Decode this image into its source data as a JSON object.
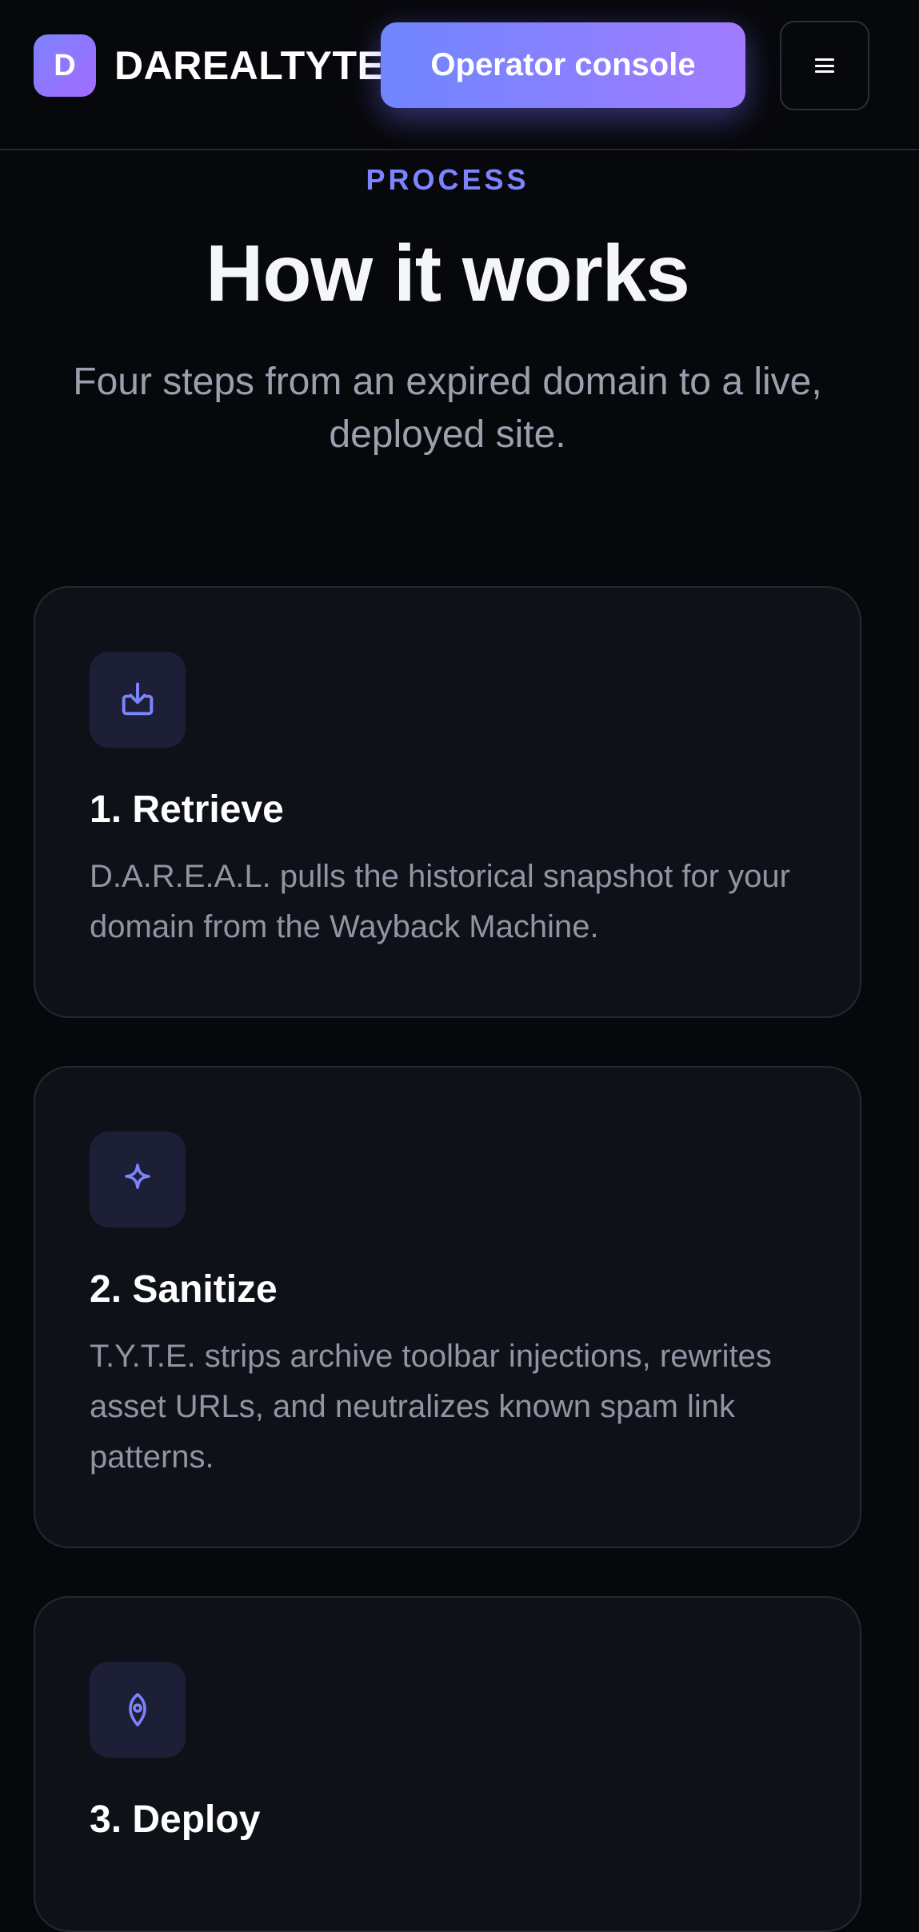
{
  "header": {
    "logo_letter": "D",
    "brand": "DAREALTYTE",
    "console_label": "Operator console",
    "menu_icon": "hamburger-menu-icon"
  },
  "section": {
    "eyebrow": "PROCESS",
    "title": "How it works",
    "subtitle": "Four steps from an expired domain to a live, deployed site."
  },
  "steps": [
    {
      "icon": "download-tray-icon",
      "title": "1. Retrieve",
      "body": "D.A.R.E.A.L. pulls the historical snapshot for your domain from the Wayback Machine."
    },
    {
      "icon": "sparkle-icon",
      "title": "2. Sanitize",
      "body": "T.Y.T.E. strips archive toolbar injections, rewrites asset URLs, and neutralizes known spam link patterns."
    },
    {
      "icon": "rocket-icon",
      "title": "3. Deploy",
      "body": ""
    }
  ],
  "colors": {
    "accent": "#7c84ff",
    "gradient_start": "#6f86ff",
    "gradient_end": "#a07bff",
    "background": "#07080b",
    "card": "#0e1118"
  }
}
